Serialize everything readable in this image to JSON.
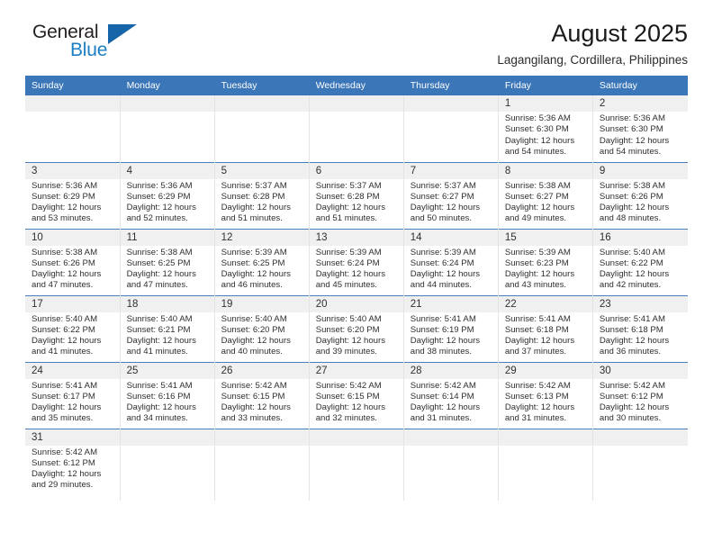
{
  "brand": {
    "name_top": "General",
    "name_bottom": "Blue",
    "triangle_color": "#1565a8",
    "blue_color": "#1c7fc4"
  },
  "header": {
    "title": "August 2025",
    "subtitle": "Lagangilang, Cordillera, Philippines"
  },
  "theme": {
    "header_blue": "#3a76b8",
    "daynum_band": "#f0f0f0",
    "text": "#2f2f2f"
  },
  "labels": {
    "sunrise_prefix": "Sunrise:",
    "sunset_prefix": "Sunset:",
    "daylight_prefix": "Daylight:"
  },
  "weekdays": [
    "Sunday",
    "Monday",
    "Tuesday",
    "Wednesday",
    "Thursday",
    "Friday",
    "Saturday"
  ],
  "weeks": [
    [
      {
        "day": "",
        "sunrise": "",
        "sunset": "",
        "daylight_1": "",
        "daylight_2": ""
      },
      {
        "day": "",
        "sunrise": "",
        "sunset": "",
        "daylight_1": "",
        "daylight_2": ""
      },
      {
        "day": "",
        "sunrise": "",
        "sunset": "",
        "daylight_1": "",
        "daylight_2": ""
      },
      {
        "day": "",
        "sunrise": "",
        "sunset": "",
        "daylight_1": "",
        "daylight_2": ""
      },
      {
        "day": "",
        "sunrise": "",
        "sunset": "",
        "daylight_1": "",
        "daylight_2": ""
      },
      {
        "day": "1",
        "sunrise": "Sunrise: 5:36 AM",
        "sunset": "Sunset: 6:30 PM",
        "daylight_1": "Daylight: 12 hours",
        "daylight_2": "and 54 minutes."
      },
      {
        "day": "2",
        "sunrise": "Sunrise: 5:36 AM",
        "sunset": "Sunset: 6:30 PM",
        "daylight_1": "Daylight: 12 hours",
        "daylight_2": "and 54 minutes."
      }
    ],
    [
      {
        "day": "3",
        "sunrise": "Sunrise: 5:36 AM",
        "sunset": "Sunset: 6:29 PM",
        "daylight_1": "Daylight: 12 hours",
        "daylight_2": "and 53 minutes."
      },
      {
        "day": "4",
        "sunrise": "Sunrise: 5:36 AM",
        "sunset": "Sunset: 6:29 PM",
        "daylight_1": "Daylight: 12 hours",
        "daylight_2": "and 52 minutes."
      },
      {
        "day": "5",
        "sunrise": "Sunrise: 5:37 AM",
        "sunset": "Sunset: 6:28 PM",
        "daylight_1": "Daylight: 12 hours",
        "daylight_2": "and 51 minutes."
      },
      {
        "day": "6",
        "sunrise": "Sunrise: 5:37 AM",
        "sunset": "Sunset: 6:28 PM",
        "daylight_1": "Daylight: 12 hours",
        "daylight_2": "and 51 minutes."
      },
      {
        "day": "7",
        "sunrise": "Sunrise: 5:37 AM",
        "sunset": "Sunset: 6:27 PM",
        "daylight_1": "Daylight: 12 hours",
        "daylight_2": "and 50 minutes."
      },
      {
        "day": "8",
        "sunrise": "Sunrise: 5:38 AM",
        "sunset": "Sunset: 6:27 PM",
        "daylight_1": "Daylight: 12 hours",
        "daylight_2": "and 49 minutes."
      },
      {
        "day": "9",
        "sunrise": "Sunrise: 5:38 AM",
        "sunset": "Sunset: 6:26 PM",
        "daylight_1": "Daylight: 12 hours",
        "daylight_2": "and 48 minutes."
      }
    ],
    [
      {
        "day": "10",
        "sunrise": "Sunrise: 5:38 AM",
        "sunset": "Sunset: 6:26 PM",
        "daylight_1": "Daylight: 12 hours",
        "daylight_2": "and 47 minutes."
      },
      {
        "day": "11",
        "sunrise": "Sunrise: 5:38 AM",
        "sunset": "Sunset: 6:25 PM",
        "daylight_1": "Daylight: 12 hours",
        "daylight_2": "and 47 minutes."
      },
      {
        "day": "12",
        "sunrise": "Sunrise: 5:39 AM",
        "sunset": "Sunset: 6:25 PM",
        "daylight_1": "Daylight: 12 hours",
        "daylight_2": "and 46 minutes."
      },
      {
        "day": "13",
        "sunrise": "Sunrise: 5:39 AM",
        "sunset": "Sunset: 6:24 PM",
        "daylight_1": "Daylight: 12 hours",
        "daylight_2": "and 45 minutes."
      },
      {
        "day": "14",
        "sunrise": "Sunrise: 5:39 AM",
        "sunset": "Sunset: 6:24 PM",
        "daylight_1": "Daylight: 12 hours",
        "daylight_2": "and 44 minutes."
      },
      {
        "day": "15",
        "sunrise": "Sunrise: 5:39 AM",
        "sunset": "Sunset: 6:23 PM",
        "daylight_1": "Daylight: 12 hours",
        "daylight_2": "and 43 minutes."
      },
      {
        "day": "16",
        "sunrise": "Sunrise: 5:40 AM",
        "sunset": "Sunset: 6:22 PM",
        "daylight_1": "Daylight: 12 hours",
        "daylight_2": "and 42 minutes."
      }
    ],
    [
      {
        "day": "17",
        "sunrise": "Sunrise: 5:40 AM",
        "sunset": "Sunset: 6:22 PM",
        "daylight_1": "Daylight: 12 hours",
        "daylight_2": "and 41 minutes."
      },
      {
        "day": "18",
        "sunrise": "Sunrise: 5:40 AM",
        "sunset": "Sunset: 6:21 PM",
        "daylight_1": "Daylight: 12 hours",
        "daylight_2": "and 41 minutes."
      },
      {
        "day": "19",
        "sunrise": "Sunrise: 5:40 AM",
        "sunset": "Sunset: 6:20 PM",
        "daylight_1": "Daylight: 12 hours",
        "daylight_2": "and 40 minutes."
      },
      {
        "day": "20",
        "sunrise": "Sunrise: 5:40 AM",
        "sunset": "Sunset: 6:20 PM",
        "daylight_1": "Daylight: 12 hours",
        "daylight_2": "and 39 minutes."
      },
      {
        "day": "21",
        "sunrise": "Sunrise: 5:41 AM",
        "sunset": "Sunset: 6:19 PM",
        "daylight_1": "Daylight: 12 hours",
        "daylight_2": "and 38 minutes."
      },
      {
        "day": "22",
        "sunrise": "Sunrise: 5:41 AM",
        "sunset": "Sunset: 6:18 PM",
        "daylight_1": "Daylight: 12 hours",
        "daylight_2": "and 37 minutes."
      },
      {
        "day": "23",
        "sunrise": "Sunrise: 5:41 AM",
        "sunset": "Sunset: 6:18 PM",
        "daylight_1": "Daylight: 12 hours",
        "daylight_2": "and 36 minutes."
      }
    ],
    [
      {
        "day": "24",
        "sunrise": "Sunrise: 5:41 AM",
        "sunset": "Sunset: 6:17 PM",
        "daylight_1": "Daylight: 12 hours",
        "daylight_2": "and 35 minutes."
      },
      {
        "day": "25",
        "sunrise": "Sunrise: 5:41 AM",
        "sunset": "Sunset: 6:16 PM",
        "daylight_1": "Daylight: 12 hours",
        "daylight_2": "and 34 minutes."
      },
      {
        "day": "26",
        "sunrise": "Sunrise: 5:42 AM",
        "sunset": "Sunset: 6:15 PM",
        "daylight_1": "Daylight: 12 hours",
        "daylight_2": "and 33 minutes."
      },
      {
        "day": "27",
        "sunrise": "Sunrise: 5:42 AM",
        "sunset": "Sunset: 6:15 PM",
        "daylight_1": "Daylight: 12 hours",
        "daylight_2": "and 32 minutes."
      },
      {
        "day": "28",
        "sunrise": "Sunrise: 5:42 AM",
        "sunset": "Sunset: 6:14 PM",
        "daylight_1": "Daylight: 12 hours",
        "daylight_2": "and 31 minutes."
      },
      {
        "day": "29",
        "sunrise": "Sunrise: 5:42 AM",
        "sunset": "Sunset: 6:13 PM",
        "daylight_1": "Daylight: 12 hours",
        "daylight_2": "and 31 minutes."
      },
      {
        "day": "30",
        "sunrise": "Sunrise: 5:42 AM",
        "sunset": "Sunset: 6:12 PM",
        "daylight_1": "Daylight: 12 hours",
        "daylight_2": "and 30 minutes."
      }
    ],
    [
      {
        "day": "31",
        "sunrise": "Sunrise: 5:42 AM",
        "sunset": "Sunset: 6:12 PM",
        "daylight_1": "Daylight: 12 hours",
        "daylight_2": "and 29 minutes."
      },
      {
        "day": "",
        "sunrise": "",
        "sunset": "",
        "daylight_1": "",
        "daylight_2": ""
      },
      {
        "day": "",
        "sunrise": "",
        "sunset": "",
        "daylight_1": "",
        "daylight_2": ""
      },
      {
        "day": "",
        "sunrise": "",
        "sunset": "",
        "daylight_1": "",
        "daylight_2": ""
      },
      {
        "day": "",
        "sunrise": "",
        "sunset": "",
        "daylight_1": "",
        "daylight_2": ""
      },
      {
        "day": "",
        "sunrise": "",
        "sunset": "",
        "daylight_1": "",
        "daylight_2": ""
      },
      {
        "day": "",
        "sunrise": "",
        "sunset": "",
        "daylight_1": "",
        "daylight_2": ""
      }
    ]
  ]
}
